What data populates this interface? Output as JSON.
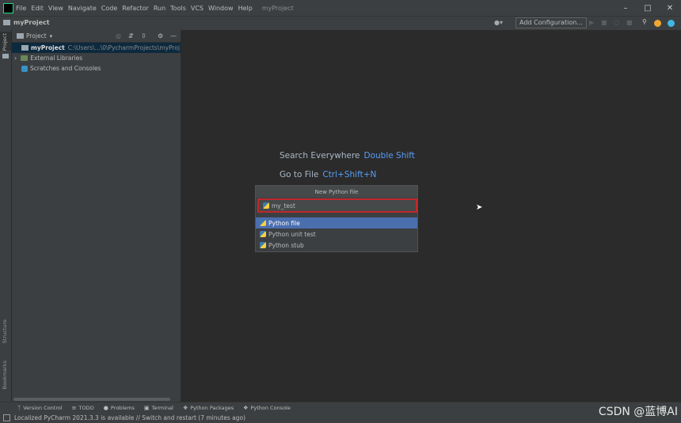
{
  "menu": [
    "File",
    "Edit",
    "View",
    "Navigate",
    "Code",
    "Refactor",
    "Run",
    "Tools",
    "VCS",
    "Window",
    "Help"
  ],
  "window_title": "myProject",
  "nav": {
    "project": "myProject",
    "run_config": "Add Configuration..."
  },
  "side_tabs": {
    "project": "Project",
    "structure": "Structure",
    "bookmarks": "Bookmarks"
  },
  "project_panel": {
    "header": "Project",
    "tree": [
      {
        "label": "myProject",
        "path": "C:\\Users\\...\\0\\PycharmProjects\\myProj"
      },
      {
        "label": "External Libraries"
      },
      {
        "label": "Scratches and Consoles"
      }
    ]
  },
  "editor_hints": [
    {
      "text": "Search Everywhere",
      "key": "Double Shift"
    },
    {
      "text": "Go to File",
      "key": "Ctrl+Shift+N"
    }
  ],
  "popup": {
    "title": "New Python file",
    "input_value": "my_test",
    "options": [
      "Python file",
      "Python unit test",
      "Python stub"
    ],
    "selected": 0
  },
  "tool_windows": [
    "Version Control",
    "TODO",
    "Problems",
    "Terminal",
    "Python Packages",
    "Python Console"
  ],
  "status": "Localized PyCharm 2021.3.3 is available // Switch and restart (7 minutes ago)",
  "watermark": "CSDN @蓝博AI",
  "colors": {
    "accent": "#589df6",
    "selection": "#4b6eaf",
    "highlight_box": "#c0282c"
  }
}
